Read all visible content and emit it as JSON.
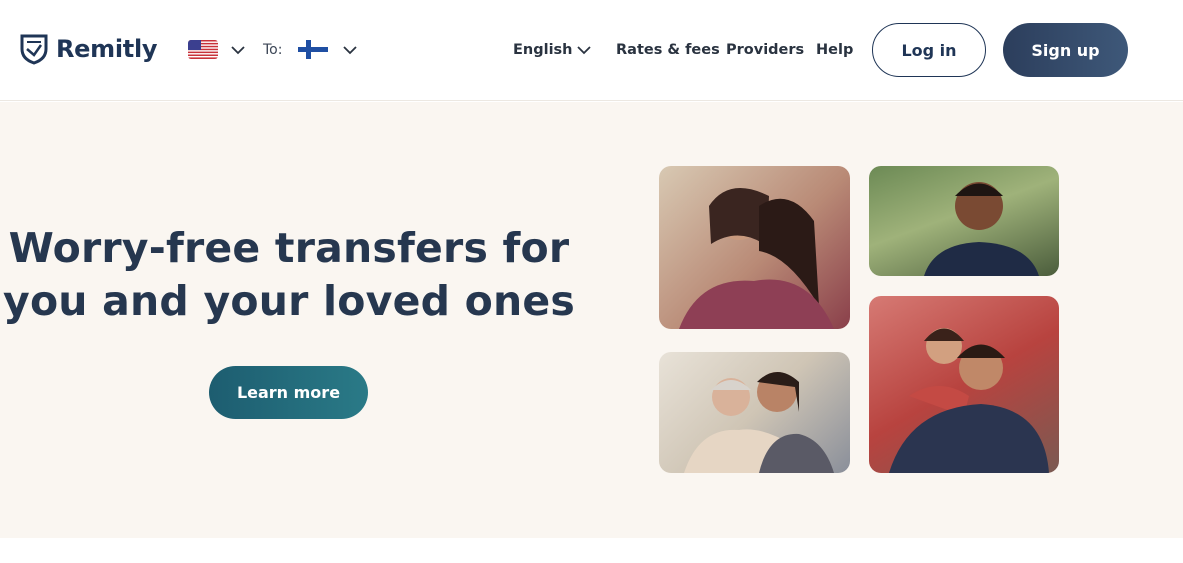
{
  "header": {
    "brand": "Remitly",
    "to_label": "To:",
    "nav": {
      "language": "English",
      "rates": "Rates & fees",
      "providers": "Providers",
      "help": "Help"
    },
    "login_label": "Log in",
    "signup_label": "Sign up"
  },
  "hero": {
    "title_line1": "Worry-free transfers for",
    "title_line2": "you and your loved ones",
    "cta_label": "Learn more"
  },
  "colors": {
    "brand_navy": "#1f3556",
    "cta_teal": "#1d5d70",
    "hero_bg": "#faf6f1"
  }
}
